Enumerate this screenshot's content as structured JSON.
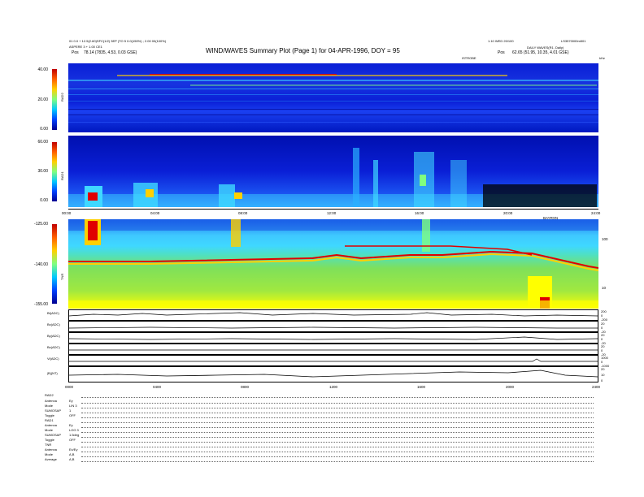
{
  "header": {
    "left_line1": "01 0.0 + 12.5(2.60)SFC(1/2) 3EP (TO 5 0.0(150%) ; 2.00 00(100%)",
    "left_line2": "ASPERE 3 + 1.00 CE1",
    "left_pos_label": "Pos",
    "left_pos_value": "78.14 (7835, 4.53, 0.03 GSE)",
    "right_line1": "1.10 WED 20/100",
    "right_line2": "DAILY WAVES(R1, Daily)",
    "right_id": "LS3570000m501",
    "right_pos_label": "Pos",
    "right_pos_value": "62.65 (51.95, 10.35, 4.01 GSE)",
    "title": "WIND/WAVES Summary Plot (Page 1) for 04-APR-1996, DOY = 95",
    "sub_label_right": "15KHZ",
    "corner_label": "kHz",
    "top_time_axis": "ISTROBE"
  },
  "panels": {
    "rad2": {
      "label": "RAD2",
      "ticks": [
        "40.00",
        "20.00",
        "0.00"
      ]
    },
    "rad1": {
      "label": "RAD1",
      "ticks": [
        "60.00",
        "30.00",
        "0.00"
      ]
    },
    "tnr": {
      "label": "TNR",
      "ticks": [
        "-125.00",
        "-140.00",
        "-155.00"
      ],
      "right_ticks": [
        "100",
        "10"
      ],
      "right_unit": "kHz"
    }
  },
  "time_axis": {
    "ticks": [
      "00:00",
      "04:00",
      "08:00",
      "12:00",
      "16:00",
      "20:00",
      "24:00"
    ],
    "mid_label": "BAYRXN"
  },
  "line_plots": [
    {
      "label": "Bt(ADC)",
      "right_ticks": [
        "200",
        "0",
        "-200"
      ]
    },
    {
      "label": "Bx(ADC)",
      "right_ticks": [
        "20",
        "0",
        "-20"
      ]
    },
    {
      "label": "By(ADC)",
      "right_ticks": [
        "20",
        "0",
        "-20"
      ]
    },
    {
      "label": "Bz(ADC)",
      "right_ticks": [
        "20",
        "0",
        "-20"
      ]
    },
    {
      "label": "Vi(ADC)",
      "right_ticks": [
        "1000",
        "0",
        "-1000"
      ]
    },
    {
      "label": "|B|(NT)",
      "right_ticks": [
        "20",
        "10",
        "0"
      ]
    }
  ],
  "bottom_time_ticks": [
    "0000",
    "0400",
    "0800",
    "1200",
    "1600",
    "2000",
    "2400"
  ],
  "legend": [
    {
      "name": "RAD2",
      "key": "",
      "value": ""
    },
    {
      "name": "",
      "key": "Antenna",
      "value": "Ey"
    },
    {
      "name": "",
      "key": "Mode",
      "value": "LIN 3"
    },
    {
      "name": "",
      "key": "SUMOSAP",
      "value": "1"
    },
    {
      "name": "",
      "key": "Toggle",
      "value": "OFF"
    },
    {
      "name": "RAD1",
      "key": "",
      "value": ""
    },
    {
      "name": "",
      "key": "Antenna",
      "value": "Ey"
    },
    {
      "name": "",
      "key": "Mode",
      "value": "LOG 3"
    },
    {
      "name": "",
      "key": "SUMOSAP",
      "value": "1.5deg"
    },
    {
      "name": "",
      "key": "Toggle",
      "value": "OFF"
    },
    {
      "name": "TNR",
      "key": "",
      "value": ""
    },
    {
      "name": "",
      "key": "Antenna",
      "value": "Ex/Ey"
    },
    {
      "name": "",
      "key": "Mode",
      "value": "A,B"
    },
    {
      "name": "",
      "key": "Average",
      "value": "A,B"
    }
  ],
  "colors": {
    "background": "#ffffff",
    "spectrum_low": "#0a1fd6",
    "spectrum_mid": "#3fd8ff",
    "spectrum_high": "#ffff00",
    "spectrum_peak": "#e00000",
    "tnr_base": "#7fe05a"
  },
  "chart_data": {
    "type": "heatmap",
    "title": "WIND/WAVES Summary Plot (Page 1) for 04-APR-1996, DOY = 95",
    "x": {
      "label": "UT",
      "ticks": [
        "00:00",
        "04:00",
        "08:00",
        "12:00",
        "16:00",
        "20:00",
        "24:00"
      ],
      "range": [
        "00:00",
        "24:00"
      ]
    },
    "panels": [
      {
        "name": "RAD2",
        "ylim": [
          0,
          40
        ],
        "yticks": [
          0,
          20,
          40
        ]
      },
      {
        "name": "RAD1",
        "ylim": [
          0,
          60
        ],
        "yticks": [
          0,
          30,
          60
        ]
      },
      {
        "name": "TNR",
        "ylim": [
          -155,
          -125
        ],
        "yticks": [
          -155,
          -140,
          -125
        ]
      }
    ],
    "line_series": [
      "Bt(ADC)",
      "Bx(ADC)",
      "By(ADC)",
      "Bz(ADC)",
      "Vi(ADC)",
      "|B|(NT)"
    ],
    "grid": false
  }
}
